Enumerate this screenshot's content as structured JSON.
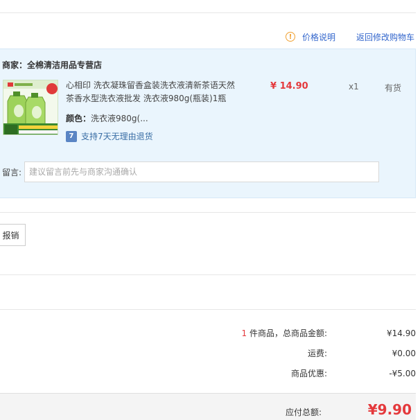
{
  "top_links": {
    "price_note_icon": "info-circle-icon",
    "price_note": "价格说明",
    "back_to_cart": "返回修改购物车"
  },
  "shop": {
    "label": "商家：全棉清洁用品专营店"
  },
  "item": {
    "thumbnail_icon": "product-thumbnail",
    "title": "心相印 洗衣凝珠留香盒装洗衣液清新茶语天然茶香水型洗衣液批发 洗衣液980g(瓶装)1瓶",
    "price": "¥ 14.90",
    "qty": "x1",
    "stock": "有货",
    "color_label": "颜色：",
    "color_value": "洗衣液980g(...",
    "return_badge": "7",
    "return_text": "支持7天无理由退货"
  },
  "remark": {
    "label": "留言:",
    "placeholder": "建议留言前先与商家沟通确认"
  },
  "invoice": {
    "button_label": "报销"
  },
  "summary": {
    "count": "1",
    "count_suffix": " 件商品，总商品金额:",
    "goods_total": "¥14.90",
    "shipping_label": "运费:",
    "shipping": "¥0.00",
    "discount_label": "商品优惠:",
    "discount": "-¥5.00"
  },
  "total": {
    "label": "应付总额:",
    "value": "¥9.90"
  },
  "colors": {
    "accent_red": "#e4393c",
    "link_blue": "#3366cc",
    "block_bg": "#eaf5fd"
  }
}
